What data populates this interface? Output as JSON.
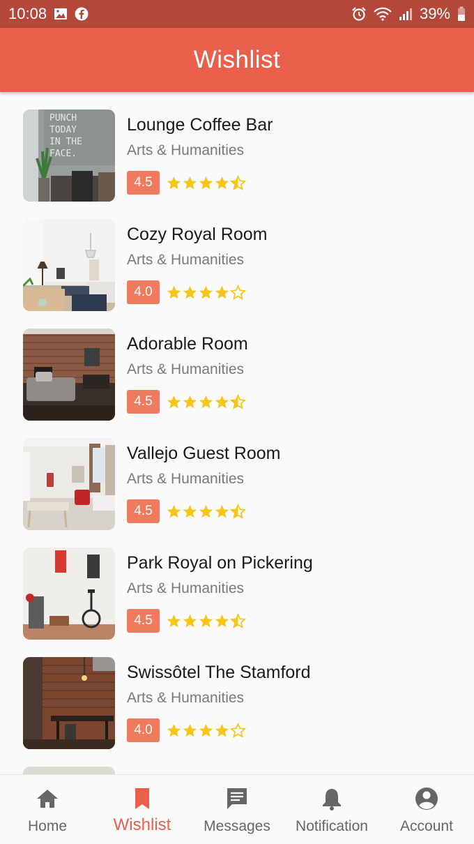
{
  "status_bar": {
    "time": "10:08",
    "battery": "39%",
    "icons": [
      "image-icon",
      "facebook-icon",
      "alarm-icon",
      "wifi-icon",
      "signal-icon",
      "battery-icon"
    ]
  },
  "app_bar": {
    "title": "Wishlist"
  },
  "colors": {
    "accent": "#e8604c",
    "status_bar": "#b5473a",
    "badge": "#f07a5e",
    "star": "#f5c518"
  },
  "wishlist": [
    {
      "name": "Lounge Coffee Bar",
      "category": "Arts & Humanities",
      "rating_label": "4.5",
      "rating": 4.5,
      "thumbnail": "coffee-bar-photo"
    },
    {
      "name": "Cozy Royal Room",
      "category": "Arts & Humanities",
      "rating_label": "4.0",
      "rating": 4.0,
      "thumbnail": "bright-room-photo"
    },
    {
      "name": "Adorable Room",
      "category": "Arts & Humanities",
      "rating_label": "4.5",
      "rating": 4.5,
      "thumbnail": "brick-living-room-photo"
    },
    {
      "name": "Vallejo Guest Room",
      "category": "Arts & Humanities",
      "rating_label": "4.5",
      "rating": 4.5,
      "thumbnail": "guest-room-photo"
    },
    {
      "name": "Park Royal on Pickering",
      "category": "Arts & Humanities",
      "rating_label": "4.5",
      "rating": 4.5,
      "thumbnail": "unicycle-room-photo"
    },
    {
      "name": "Swissôtel The Stamford",
      "category": "Arts & Humanities",
      "rating_label": "4.0",
      "rating": 4.0,
      "thumbnail": "brick-dining-photo"
    }
  ],
  "bottom_nav": [
    {
      "label": "Home",
      "icon": "home-icon",
      "active": false
    },
    {
      "label": "Wishlist",
      "icon": "bookmark-icon",
      "active": true
    },
    {
      "label": "Messages",
      "icon": "message-icon",
      "active": false
    },
    {
      "label": "Notification",
      "icon": "bell-icon",
      "active": false
    },
    {
      "label": "Account",
      "icon": "account-icon",
      "active": false
    }
  ]
}
